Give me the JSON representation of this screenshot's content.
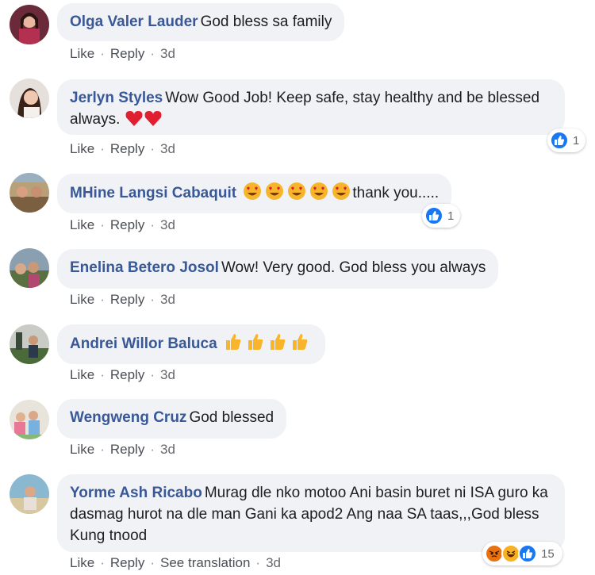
{
  "actions": {
    "like": "Like",
    "reply": "Reply",
    "sep": "·",
    "see_translation": "See translation"
  },
  "comments": [
    {
      "author": "Olga Valer Lauder",
      "text": "God bless sa family",
      "time": "3d"
    },
    {
      "author": "Jerlyn Styles",
      "text": "Wow Good Job! Keep safe, stay healthy and be blessed always.",
      "emoji": "heart ×2",
      "time": "3d",
      "reaction_count": "1"
    },
    {
      "author": "MHine Langsi Cabaquit",
      "emoji": "heart-eyes ×5",
      "text": "thank you.....",
      "time": "3d",
      "reaction_count": "1"
    },
    {
      "author": "Enelina Betero Josol",
      "text": "Wow! Very good. God bless you always",
      "time": "3d"
    },
    {
      "author": "Andrei Willor Baluca",
      "emoji": "thumbs-up ×4",
      "text": "",
      "time": "3d"
    },
    {
      "author": "Wengweng Cruz",
      "text": "God blessed",
      "time": "3d"
    },
    {
      "author": "Yorme Ash Ricabo",
      "text": "Murag dle nko motoo Ani basin buret ni ISA guro ka dasmag hurot na dle man Gani ka apod2 Ang naa SA taas,,,God bless Kung tnood",
      "time": "3d",
      "reaction_count": "15",
      "reaction_icons": [
        "angry-icon",
        "haha-icon",
        "like-icon"
      ]
    }
  ],
  "colors": {
    "author": "#385898",
    "bubble": "#f0f2f5",
    "like_blue": "#1877f2"
  }
}
